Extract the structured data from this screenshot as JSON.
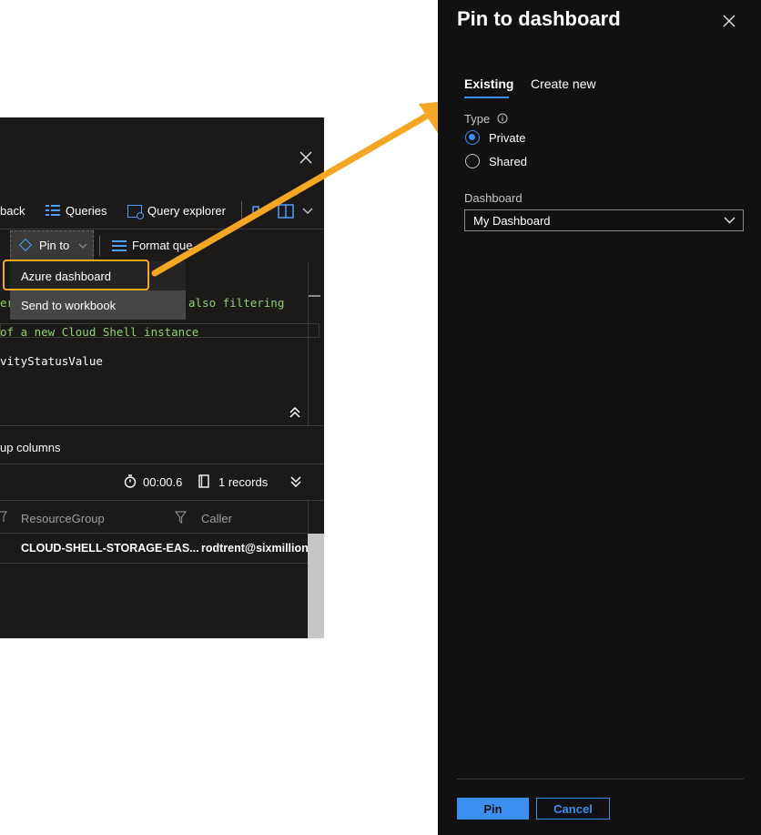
{
  "editor": {
    "toolbar_row1": {
      "feedback_label": "back",
      "queries_label": "Queries",
      "query_explorer_label": "Query explorer"
    },
    "toolbar_row2": {
      "pin_to_label": "Pin to",
      "format_query_label": "Format que"
    },
    "pin_menu": {
      "items": [
        "Azure dashboard",
        "Send to workbook"
      ]
    },
    "code_lines": [
      "er",
      "also filtering",
      "of a new Cloud Shell instance",
      "vityStatusValue"
    ],
    "group_columns_label": "up columns",
    "stats": {
      "duration": "00:00.6",
      "records": "1 records"
    },
    "table": {
      "headers": [
        "ResourceGroup",
        "Caller"
      ],
      "rows": [
        [
          "CLOUD-SHELL-STORAGE-EAS...",
          "rodtrent@sixmillion"
        ]
      ]
    }
  },
  "panel": {
    "title": "Pin to dashboard",
    "tabs": [
      "Existing",
      "Create new"
    ],
    "active_tab": "Existing",
    "type_label": "Type",
    "type_options": [
      "Private",
      "Shared"
    ],
    "type_selected": "Private",
    "dashboard_label": "Dashboard",
    "dashboard_value": "My Dashboard",
    "pin_label": "Pin",
    "cancel_label": "Cancel"
  },
  "colors": {
    "accent": "#3c8ff0",
    "highlight": "#f5a623",
    "panel_bg": "#111111",
    "editor_bg": "#1b1a19",
    "code_green": "#8fd36e"
  },
  "icons": [
    "close-icon",
    "queries-icon",
    "query-explorer-icon",
    "book-icon",
    "chevron-down-icon",
    "pin-icon",
    "format-icon",
    "collapse-up-icon",
    "timer-icon",
    "records-icon",
    "expand-down-icon",
    "filter-icon",
    "info-icon",
    "arrow-annotation"
  ]
}
